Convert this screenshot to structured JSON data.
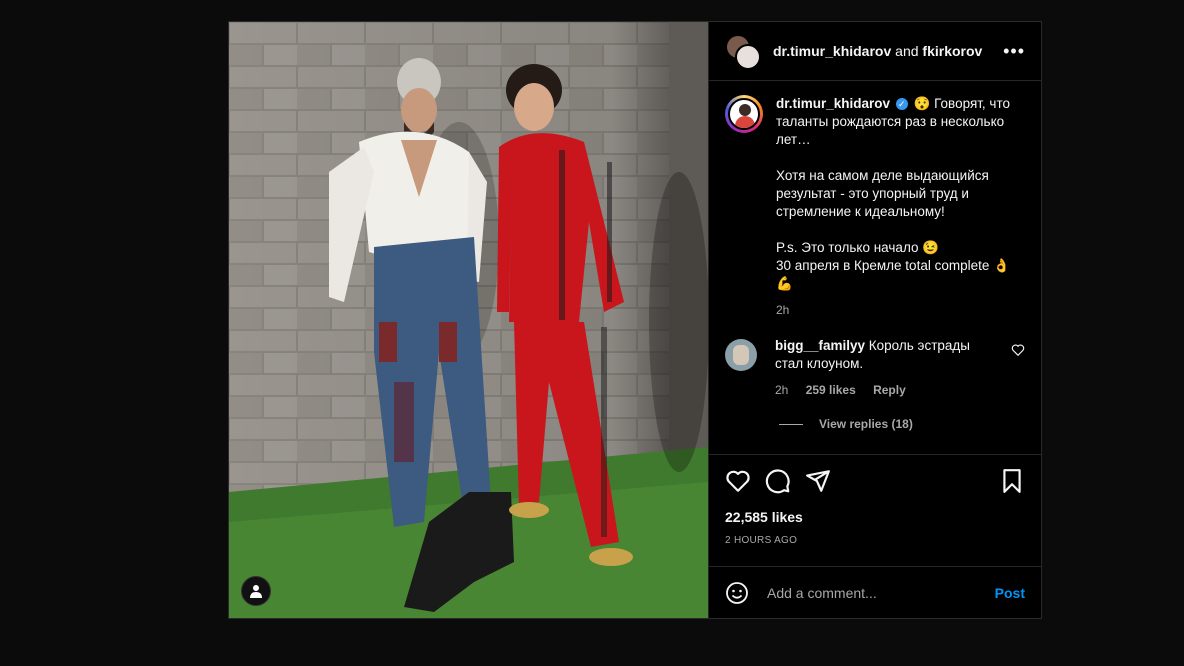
{
  "header": {
    "user1": "dr.timur_khidarov",
    "and": "and",
    "user2": "fkirkorov",
    "more_icon": "more-horizontal-icon"
  },
  "caption": {
    "username": "dr.timur_khidarov",
    "verified_icon": "verified-badge-icon",
    "text": "😯 Говорят, что таланты рождаются раз в несколько лет…\n\nХотя на самом деле выдающийся результат - это упорный труд и стремление к идеальному!\n\nP.s. Это только начало 😉\n30 апреля в Кремле total complete 👌💪",
    "time": "2h"
  },
  "comment": {
    "username": "bigg__familyy",
    "text": "Король эстрады стал клоуном.",
    "time": "2h",
    "likes": "259 likes",
    "reply": "Reply",
    "view_replies": "View replies (18)"
  },
  "actions": {
    "likes": "22,585 likes",
    "ago": "2 HOURS AGO"
  },
  "add_comment": {
    "placeholder": "Add a comment...",
    "post": "Post"
  },
  "colors": {
    "accent": "#0095f6",
    "verified": "#3897f0",
    "background": "#000000"
  }
}
